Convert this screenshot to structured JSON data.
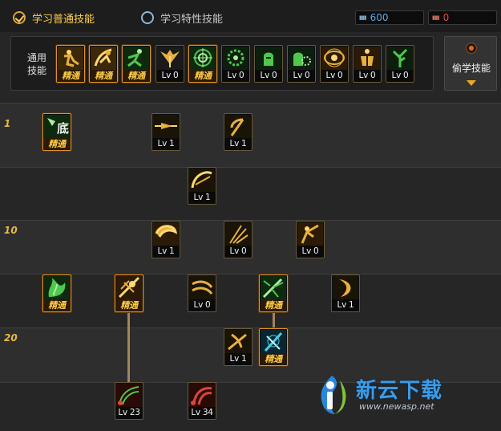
{
  "tabs": {
    "normal": {
      "label": "学习普通技能",
      "selected": true
    },
    "special": {
      "label": "学习特性技能",
      "selected": false
    }
  },
  "points": {
    "sp": {
      "icon": "sp-icon",
      "value": "600",
      "color": "#5aa8f0"
    },
    "tp": {
      "icon": "tp-icon",
      "value": "0",
      "color": "#e04a3a"
    }
  },
  "common": {
    "label_line1": "通用",
    "label_line2": "技能",
    "skills": [
      {
        "icon": "sit-figure-icon",
        "level": "精通"
      },
      {
        "icon": "leap-figure-icon",
        "level": "精通"
      },
      {
        "icon": "sprint-figure-icon",
        "level": "精通"
      },
      {
        "icon": "wings-icon",
        "level": "Lv 0"
      },
      {
        "icon": "target-icon",
        "level": "精通"
      },
      {
        "icon": "gear-target-icon",
        "level": "Lv 0"
      },
      {
        "icon": "armor-head-icon",
        "level": "Lv 0"
      },
      {
        "icon": "armor-gear-icon",
        "level": "Lv 0"
      },
      {
        "icon": "eye-icon",
        "level": "Lv 0"
      },
      {
        "icon": "armor-body-icon",
        "level": "Lv 0"
      },
      {
        "icon": "tree-icon",
        "level": "Lv 0"
      }
    ]
  },
  "steal": {
    "label": "偷学技能",
    "icon": "flame-icon",
    "arrow": "dropdown-arrow-icon"
  },
  "levels": [
    "1",
    "10",
    "20"
  ],
  "tree": [
    {
      "icon": "base-stance-icon",
      "level": "精通"
    },
    {
      "icon": "dash-icon",
      "level": "Lv 1"
    },
    {
      "icon": "scythe-icon",
      "level": "Lv 1"
    },
    {
      "icon": "slash-arc-icon",
      "level": "Lv 1"
    },
    {
      "icon": "spin-slash-icon",
      "level": "Lv 1"
    },
    {
      "icon": "triple-blade-icon",
      "level": "Lv 0"
    },
    {
      "icon": "knight-strike-icon",
      "level": "Lv 0"
    },
    {
      "icon": "green-flame-icon",
      "level": "精通"
    },
    {
      "icon": "sword-burst-icon",
      "level": "精通"
    },
    {
      "icon": "wind-wave-icon",
      "level": "Lv 0"
    },
    {
      "icon": "green-burst-icon",
      "level": "精通"
    },
    {
      "icon": "crescent-icon",
      "level": "Lv 1"
    },
    {
      "icon": "cross-slash-icon",
      "level": "Lv 1"
    },
    {
      "icon": "ice-sword-icon",
      "level": "精通"
    },
    {
      "icon": "red-wave-icon",
      "level": "Lv 23"
    },
    {
      "icon": "red-claw-icon",
      "level": "Lv 34"
    }
  ],
  "watermark": {
    "title": "新云下载",
    "url": "www.newasp.net"
  },
  "colors": {
    "accent": "#ffcf4a",
    "master_border": "#e2922a",
    "level_text": "#e8b848"
  }
}
